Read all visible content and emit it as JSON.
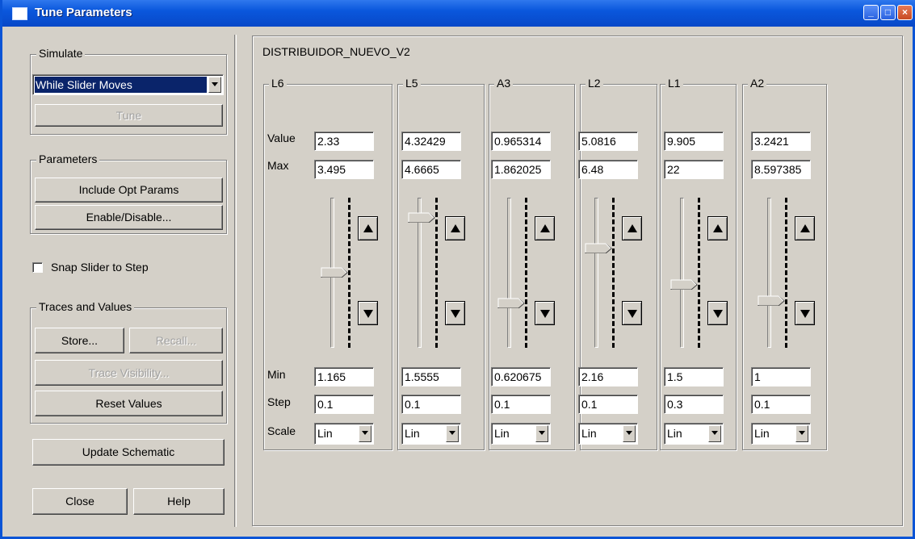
{
  "window": {
    "title": "Tune Parameters"
  },
  "simulate": {
    "label": "Simulate",
    "mode": "While Slider Moves",
    "tune_label": "Tune"
  },
  "parameters": {
    "label": "Parameters",
    "include_opt": "Include Opt Params",
    "enable_disable": "Enable/Disable..."
  },
  "snap": {
    "label": "Snap Slider to Step",
    "checked": false
  },
  "traces": {
    "label": "Traces and Values",
    "store": "Store...",
    "recall": "Recall...",
    "trace_visibility": "Trace Visibility...",
    "reset": "Reset Values"
  },
  "update_schematic": "Update Schematic",
  "close": "Close",
  "help": "Help",
  "panel_title": "DISTRIBUIDOR_NUEVO_V2",
  "row_labels": {
    "value": "Value",
    "max": "Max",
    "min": "Min",
    "step": "Step",
    "scale": "Scale"
  },
  "params": [
    {
      "name": "L6",
      "value": "2.33",
      "max": "3.495",
      "min": "1.165",
      "step": "0.1",
      "scale": "Lin",
      "slider_pos": 0.5
    },
    {
      "name": "L5",
      "value": "4.32429",
      "max": "4.6665",
      "min": "1.5555",
      "step": "0.1",
      "scale": "Lin",
      "slider_pos": 0.897
    },
    {
      "name": "A3",
      "value": "0.965314",
      "max": "1.862025",
      "min": "0.620675",
      "step": "0.1",
      "scale": "Lin",
      "slider_pos": 0.278
    },
    {
      "name": "L2",
      "value": "5.0816",
      "max": "6.48",
      "min": "2.16",
      "step": "0.1",
      "scale": "Lin",
      "slider_pos": 0.676
    },
    {
      "name": "L1",
      "value": "9.905",
      "max": "22",
      "min": "1.5",
      "step": "0.3",
      "scale": "Lin",
      "slider_pos": 0.41
    },
    {
      "name": "A2",
      "value": "3.2421",
      "max": "8.597385",
      "min": "1",
      "step": "0.1",
      "scale": "Lin",
      "slider_pos": 0.296
    }
  ]
}
